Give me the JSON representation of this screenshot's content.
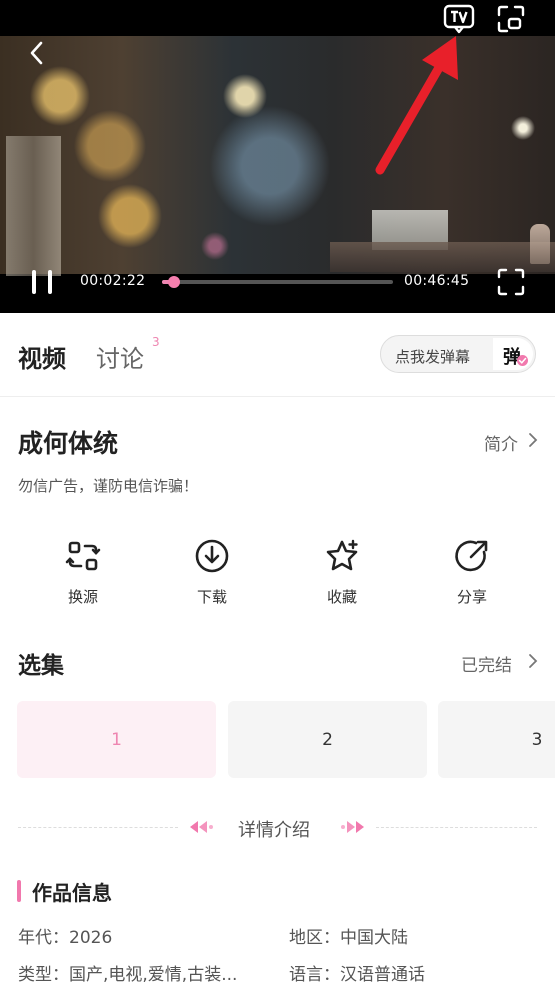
{
  "player": {
    "current_time": "00:02:22",
    "total_time": "00:46:45",
    "progress_fraction": 0.05,
    "accent_color": "#f178ad",
    "icons": [
      "back-icon",
      "tv-cast-icon",
      "picture-in-picture-icon",
      "pause-icon",
      "fullscreen-icon"
    ]
  },
  "tabs": {
    "video": "视频",
    "discuss": "讨论",
    "discuss_count": "3"
  },
  "danmaku": {
    "placeholder": "点我发弹幕",
    "icon_char": "弹"
  },
  "show": {
    "title": "成何体统",
    "intro_link": "简介",
    "notice": "勿信广告，谨防电信诈骗！"
  },
  "actions": [
    {
      "label": "换源",
      "icon": "switch-source-icon"
    },
    {
      "label": "下载",
      "icon": "download-icon"
    },
    {
      "label": "收藏",
      "icon": "star-icon"
    },
    {
      "label": "分享",
      "icon": "share-icon"
    }
  ],
  "episodes": {
    "header": "选集",
    "status": "已完结",
    "items": [
      "1",
      "2",
      "3"
    ],
    "selected": "1"
  },
  "details": {
    "divider_title": "详情介绍",
    "section_title": "作品信息",
    "year": "年代：2026",
    "region": "地区：中国大陆",
    "genre": "类型：国产,电视,爱情,古装...",
    "language": "语言：汉语普通话"
  }
}
